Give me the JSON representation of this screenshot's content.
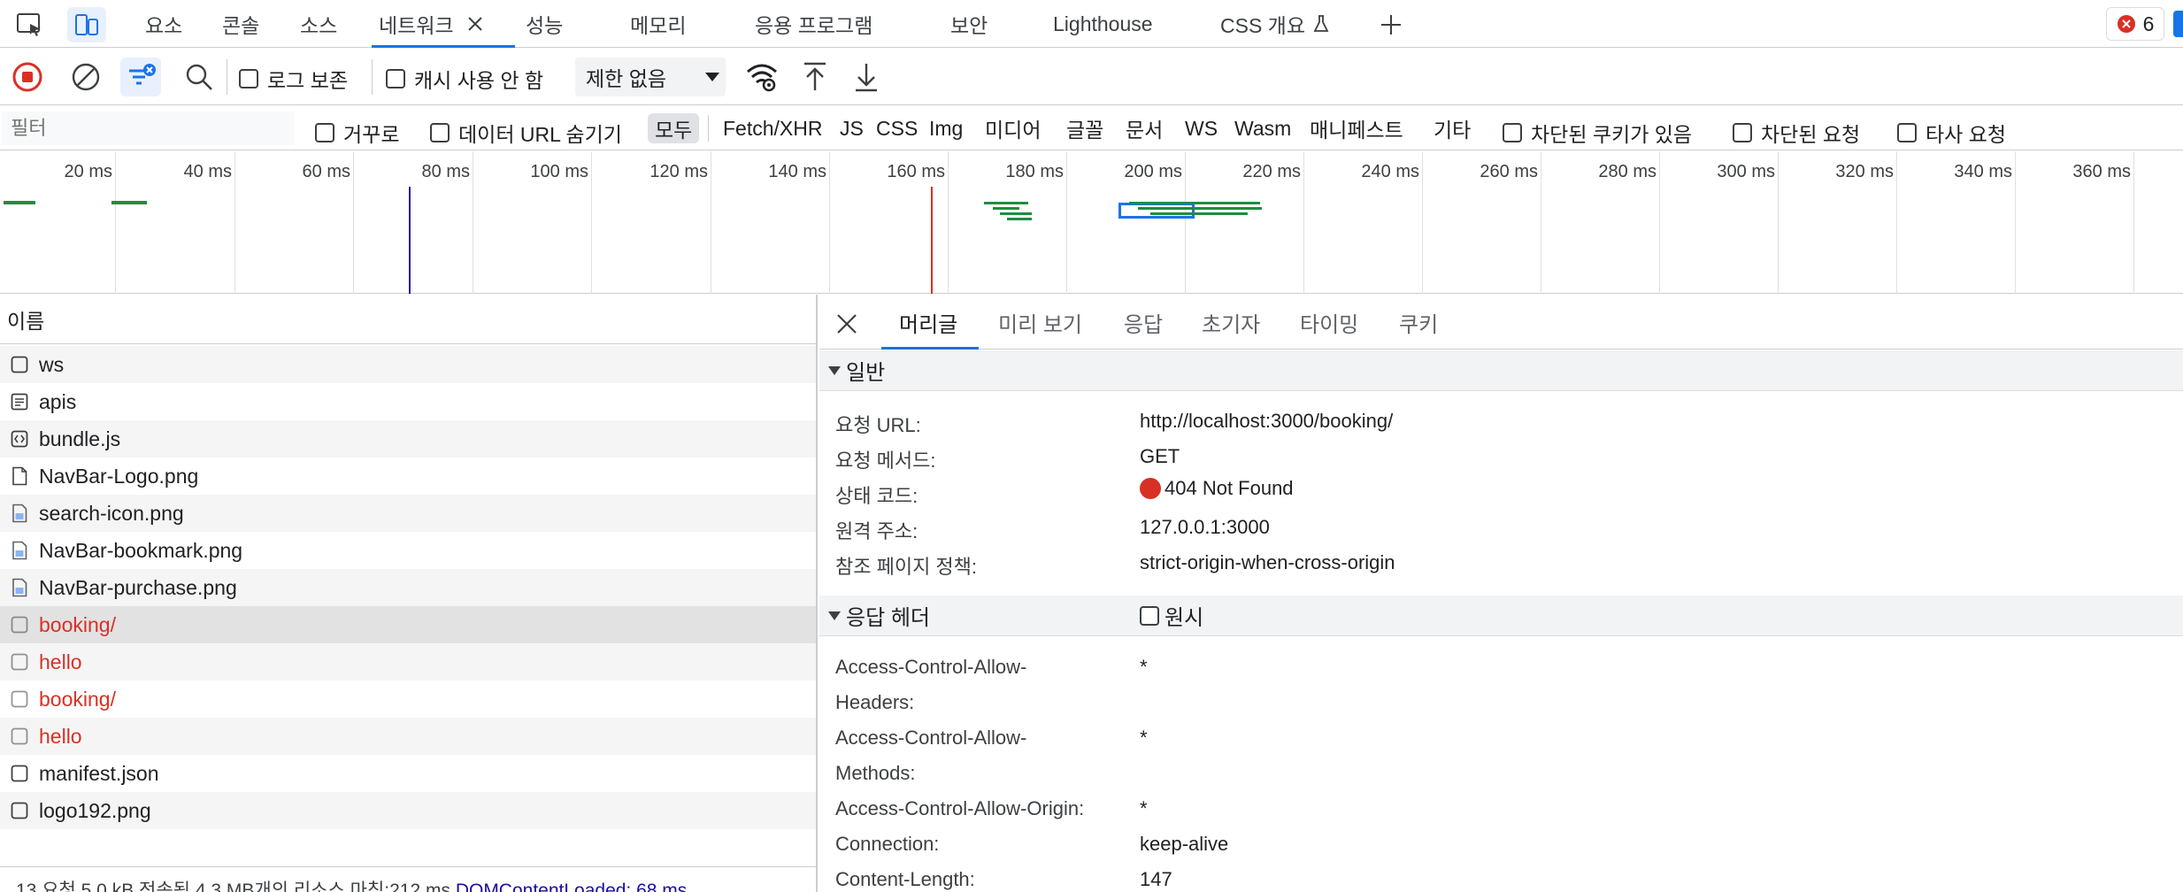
{
  "tabs": {
    "items": [
      "요소",
      "콘솔",
      "소스",
      "네트워크",
      "성능",
      "메모리",
      "응용 프로그램",
      "보안",
      "Lighthouse",
      "CSS 개요"
    ],
    "active_index": 3,
    "error_count": "6"
  },
  "toolbar": {
    "preserve_log_label": "로그 보존",
    "disable_cache_label": "캐시 사용 안 함",
    "throttle_value": "제한 없음"
  },
  "filter": {
    "placeholder": "필터",
    "invert_label": "거꾸로",
    "hide_data_urls_label": "데이터 URL 숨기기",
    "types": [
      "모두",
      "Fetch/XHR",
      "JS",
      "CSS",
      "Img",
      "미디어",
      "글꼴",
      "문서",
      "WS",
      "Wasm",
      "매니페스트",
      "기타"
    ],
    "active_type": "모두",
    "blocked_cookies_label": "차단된 쿠키가 있음",
    "blocked_requests_label": "차단된 요청",
    "third_party_label": "타사 요청"
  },
  "timeline": {
    "ticks": [
      "20 ms",
      "40 ms",
      "60 ms",
      "80 ms",
      "100 ms",
      "120 ms",
      "140 ms",
      "160 ms",
      "180 ms",
      "200 ms",
      "220 ms",
      "240 ms",
      "260 ms",
      "280 ms",
      "300 ms",
      "320 ms",
      "340 ms",
      "360 ms"
    ],
    "colors": {
      "blue_line": "#1a1aa6",
      "red_line": "#d93025",
      "bar_green": "#1e8e3e",
      "bar_blue": "#1a73e8"
    }
  },
  "requests": {
    "header": "이름",
    "rows": [
      {
        "name": "ws",
        "icon": "checkbox-icon",
        "error": false
      },
      {
        "name": "apis",
        "icon": "document-icon",
        "error": false
      },
      {
        "name": "bundle.js",
        "icon": "script-icon",
        "error": false
      },
      {
        "name": "NavBar-Logo.png",
        "icon": "file-icon",
        "error": false
      },
      {
        "name": "search-icon.png",
        "icon": "image-icon",
        "error": false
      },
      {
        "name": "NavBar-bookmark.png",
        "icon": "image-icon",
        "error": false
      },
      {
        "name": "NavBar-purchase.png",
        "icon": "image-icon",
        "error": false
      },
      {
        "name": "booking/",
        "icon": "checkbox-icon",
        "error": true
      },
      {
        "name": "hello",
        "icon": "checkbox-icon",
        "error": true
      },
      {
        "name": "booking/",
        "icon": "checkbox-icon",
        "error": true
      },
      {
        "name": "hello",
        "icon": "checkbox-icon",
        "error": true
      },
      {
        "name": "manifest.json",
        "icon": "checkbox-icon",
        "error": false
      },
      {
        "name": "logo192.png",
        "icon": "checkbox-icon",
        "error": false
      }
    ],
    "selected_index": 7,
    "summary": "13 요청 5.0 kB 전송됨 4.3 MB개의 리소스 마침:212 ms",
    "summary_dcl": "DOMContentLoaded: 68 ms"
  },
  "details": {
    "tabs": [
      "머리글",
      "미리 보기",
      "응답",
      "초기자",
      "타이밍",
      "쿠키"
    ],
    "active_tab": "머리글",
    "general_title": "일반",
    "general": [
      {
        "key": "요청 URL:",
        "value": "http://localhost:3000/booking/"
      },
      {
        "key": "요청 메서드:",
        "value": "GET"
      },
      {
        "key": "상태 코드:",
        "value": "404 Not Found"
      },
      {
        "key": "원격 주소:",
        "value": "127.0.0.1:3000"
      },
      {
        "key": "참조 페이지 정책:",
        "value": "strict-origin-when-cross-origin"
      }
    ],
    "response_headers_title": "응답 헤더",
    "raw_label": "원시",
    "response_headers": [
      {
        "key": "Access-Control-Allow-",
        "key2": "Headers:",
        "value": "*"
      },
      {
        "key": "Access-Control-Allow-",
        "key2": "Methods:",
        "value": "*"
      },
      {
        "key": "Access-Control-Allow-Origin:",
        "key2": "",
        "value": "*"
      },
      {
        "key": "Connection:",
        "key2": "",
        "value": "keep-alive"
      },
      {
        "key": "Content-Length:",
        "key2": "",
        "value": "147"
      }
    ],
    "status_color": "#d93025"
  }
}
